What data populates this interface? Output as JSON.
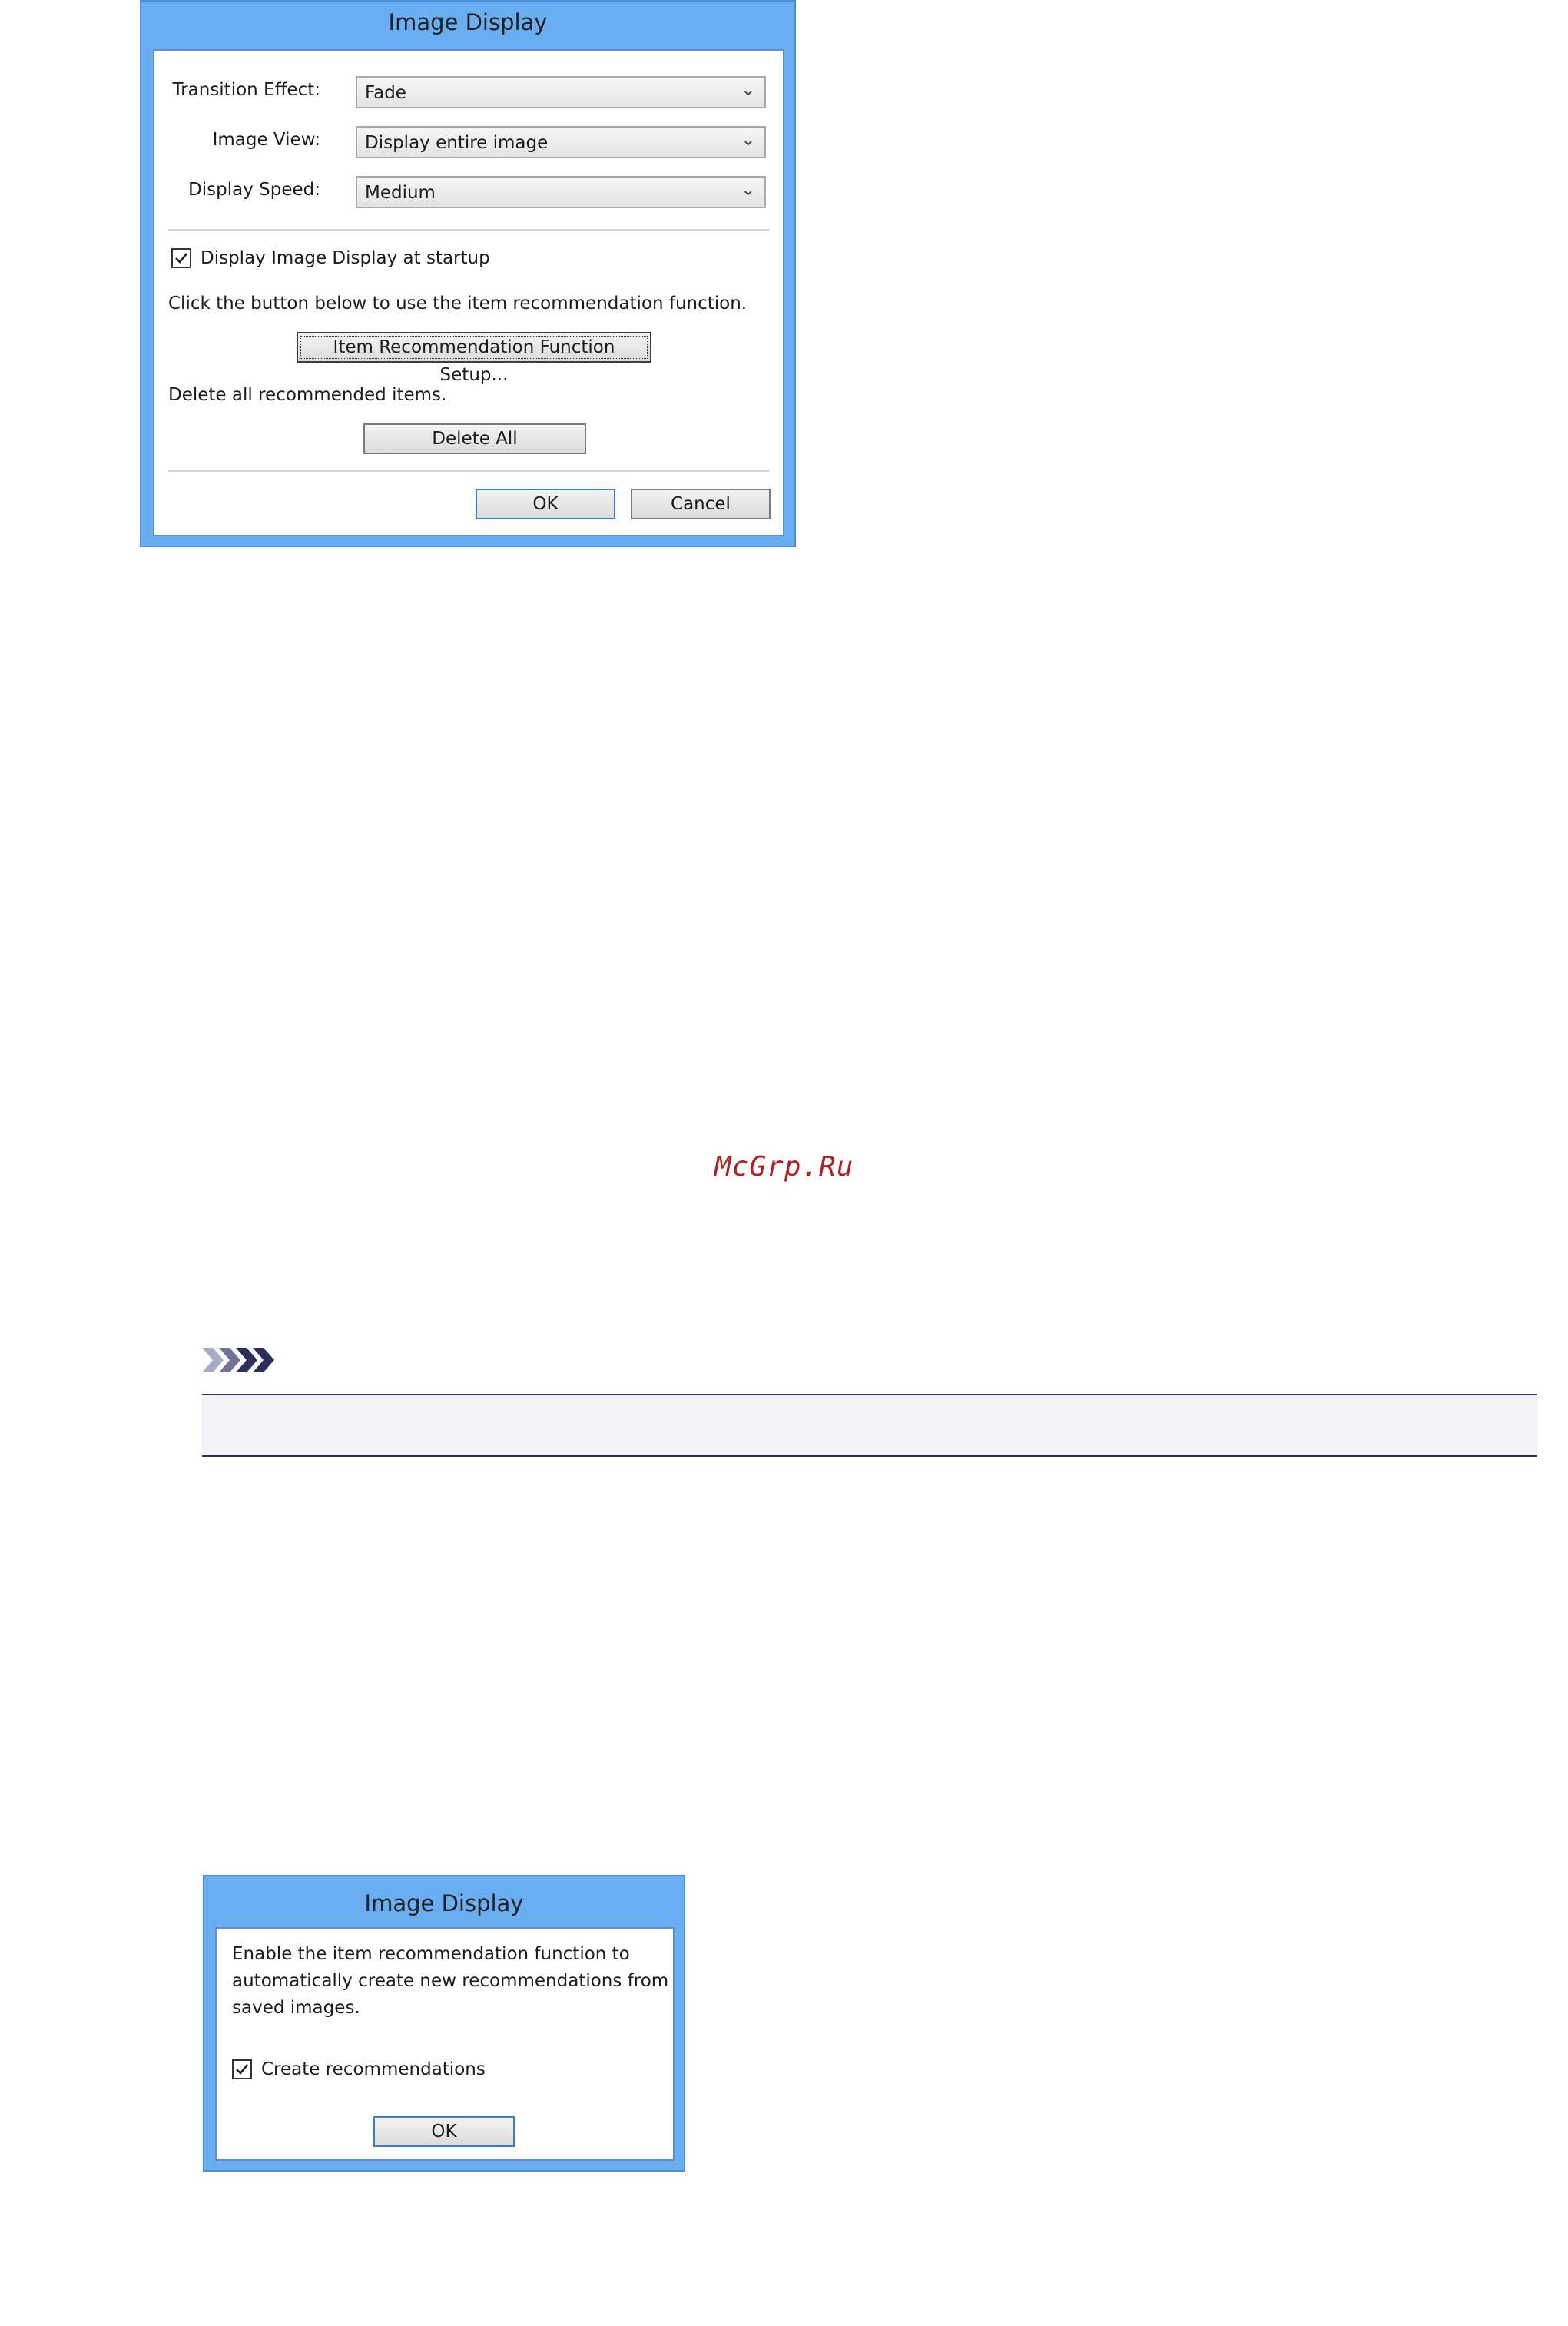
{
  "dialog1": {
    "title": "Image Display",
    "transition_effect": {
      "label": "Transition Effect:",
      "value": "Fade"
    },
    "image_view": {
      "label": "Image View:",
      "value": "Display entire image"
    },
    "display_speed": {
      "label": "Display Speed:",
      "value": "Medium"
    },
    "startup_checkbox": {
      "label": "Display Image Display at startup",
      "checked": true
    },
    "recommend_hint": "Click the button below to use the item recommendation function.",
    "recommend_button": "Item Recommendation Function Setup...",
    "delete_hint": "Delete all recommended items.",
    "delete_button": "Delete All",
    "ok_button": "OK",
    "cancel_button": "Cancel"
  },
  "watermark": "McGrp.Ru",
  "dialog2": {
    "title": "Image Display",
    "description_lines": [
      "Enable the item recommendation function to",
      "automatically create new recommendations from",
      "saved images."
    ],
    "create_checkbox": {
      "label": "Create recommendations",
      "checked": true
    },
    "ok_button": "OK"
  },
  "colors": {
    "dialog_frame": "#6aaef2",
    "watermark": "#b22222",
    "note_chevron_light": "#a8aac6",
    "note_chevron_dark": "#2b2f5a"
  },
  "icons": {
    "note": "note-chevrons-icon",
    "checkmark": "checkmark-icon",
    "dropdown": "chevron-down-icon"
  }
}
